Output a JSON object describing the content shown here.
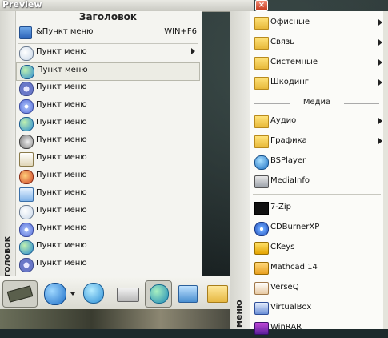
{
  "window": {
    "title": "Preview",
    "close_glyph": "×"
  },
  "left_menu": {
    "band_label": "Заголовок",
    "header": "Заголовок",
    "top_item": {
      "label": "&Пункт меню",
      "shortcut": "WIN+F6",
      "icon": "window-icon"
    },
    "items": [
      {
        "label": "Пункт меню",
        "icon": "clock-icon",
        "has_submenu": true,
        "selected": false
      },
      {
        "label": "Пункт меню",
        "icon": "globe-icon",
        "has_submenu": false,
        "selected": true
      },
      {
        "label": "Пункт меню",
        "icon": "gear-icon",
        "has_submenu": false,
        "selected": false
      },
      {
        "label": "Пункт меню",
        "icon": "disc-icon",
        "has_submenu": false,
        "selected": false
      },
      {
        "label": "Пункт меню",
        "icon": "globe-icon",
        "has_submenu": false,
        "selected": false
      },
      {
        "label": "Пункт меню",
        "icon": "speaker-icon",
        "has_submenu": false,
        "selected": false
      },
      {
        "label": "Пункт меню",
        "icon": "download-icon",
        "has_submenu": false,
        "selected": false
      },
      {
        "label": "Пункт меню",
        "icon": "users-icon",
        "has_submenu": false,
        "selected": false
      },
      {
        "label": "Пункт меню",
        "icon": "display-icon",
        "has_submenu": false,
        "selected": false
      },
      {
        "label": "Пункт меню",
        "icon": "clock-icon",
        "has_submenu": false,
        "selected": false
      },
      {
        "label": "Пункт меню",
        "icon": "disc-icon",
        "has_submenu": false,
        "selected": false
      },
      {
        "label": "Пункт меню",
        "icon": "globe-icon",
        "has_submenu": false,
        "selected": false
      },
      {
        "label": "Пункт меню",
        "icon": "gear-icon",
        "has_submenu": false,
        "selected": false
      }
    ]
  },
  "toolbar": {
    "buttons": [
      {
        "icon": "memory-chip-icon",
        "selected": true
      },
      {
        "icon": "ie-globe-icon",
        "selected": false
      },
      {
        "icon": "globe-mouse-icon",
        "selected": false
      },
      {
        "icon": "printer-icon",
        "selected": false
      },
      {
        "icon": "network-globe-icon",
        "selected": false
      },
      {
        "icon": "network-icon",
        "selected": false
      },
      {
        "icon": "folder-apps-icon",
        "selected": false
      }
    ]
  },
  "right_menu": {
    "band_label": "меню",
    "section_header": "Медиа",
    "folders_top": [
      {
        "label": "Офисные",
        "icon": "folder-icon"
      },
      {
        "label": "Связь",
        "icon": "folder-icon"
      },
      {
        "label": "Системные",
        "icon": "folder-icon"
      },
      {
        "label": "Шкодинг",
        "icon": "folder-icon"
      }
    ],
    "folders_media": [
      {
        "label": "Аудио",
        "icon": "folder-icon"
      },
      {
        "label": "Графика",
        "icon": "folder-icon"
      }
    ],
    "apps_media": [
      {
        "label": "BSPlayer",
        "icon": "bsplayer-icon"
      },
      {
        "label": "MediaInfo",
        "icon": "mediainfo-icon"
      }
    ],
    "apps": [
      {
        "label": "7-Zip",
        "icon": "sevenzip-icon"
      },
      {
        "label": "CDBurnerXP",
        "icon": "cdburner-icon"
      },
      {
        "label": "CKeys",
        "icon": "ckeys-icon"
      },
      {
        "label": "Mathcad 14",
        "icon": "mathcad-icon"
      },
      {
        "label": "VerseQ",
        "icon": "verseq-icon"
      },
      {
        "label": "VirtualBox",
        "icon": "virtualbox-icon"
      },
      {
        "label": "WinRAR",
        "icon": "winrar-icon"
      }
    ]
  }
}
